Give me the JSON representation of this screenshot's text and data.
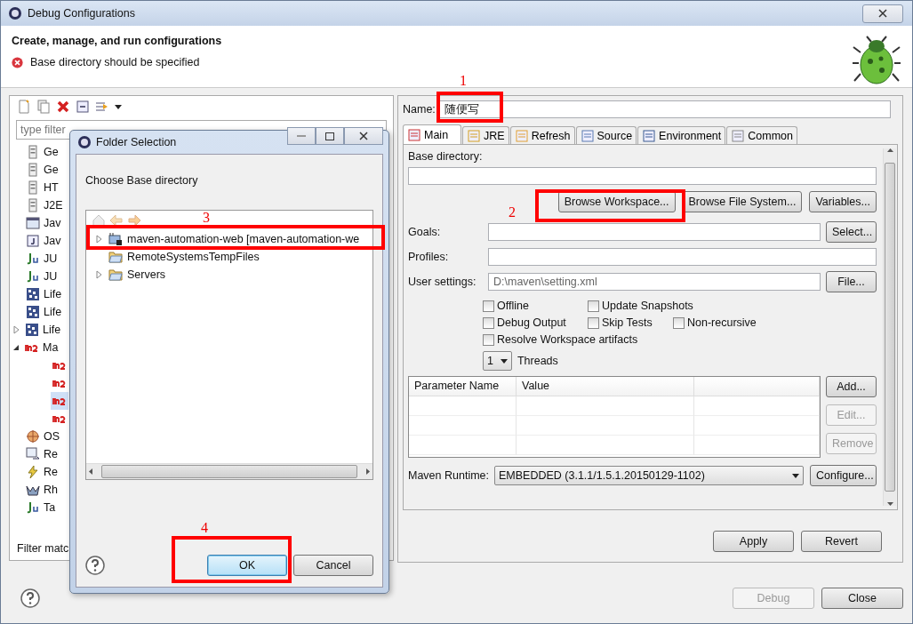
{
  "window": {
    "title": "Debug Configurations"
  },
  "header": {
    "title": "Create, manage, and run configurations",
    "error": "Base directory should be specified"
  },
  "left_panel": {
    "filter": {
      "placeholder": "type filter"
    },
    "items": [
      {
        "kind": "doc",
        "label": "Ge"
      },
      {
        "kind": "doc",
        "label": "Ge"
      },
      {
        "kind": "doc",
        "label": "HT"
      },
      {
        "kind": "doc",
        "label": "J2E"
      },
      {
        "kind": "javaapp",
        "label": "Jav"
      },
      {
        "kind": "javaclass",
        "label": "Jav"
      },
      {
        "kind": "junit",
        "label": "JU"
      },
      {
        "kind": "junit",
        "label": "JU"
      },
      {
        "kind": "lifecycle",
        "label": "Life"
      },
      {
        "kind": "lifecycle",
        "label": "Life"
      },
      {
        "kind": "lifecycle",
        "label": "Life",
        "expanded": false
      },
      {
        "kind": "maven",
        "label": "Ma",
        "expanded": true,
        "children": [
          {
            "kind": "maven",
            "selected": false
          },
          {
            "kind": "maven",
            "selected": false
          },
          {
            "kind": "maven",
            "selected": true
          },
          {
            "kind": "maven",
            "selected": false
          }
        ]
      },
      {
        "kind": "osgi",
        "label": "OS"
      },
      {
        "kind": "remote",
        "label": "Re"
      },
      {
        "kind": "bolt",
        "label": "Re"
      },
      {
        "kind": "rhino",
        "label": "Rh"
      },
      {
        "kind": "junit",
        "label": "Ta"
      }
    ],
    "status": "Filter matc"
  },
  "form": {
    "name_label": "Name:",
    "name_value": "随便写",
    "tabs": [
      {
        "label": "Main",
        "selected": true
      },
      {
        "label": "JRE",
        "selected": false
      },
      {
        "label": "Refresh",
        "selected": false
      },
      {
        "label": "Source",
        "selected": false
      },
      {
        "label": "Environment",
        "selected": false
      },
      {
        "label": "Common",
        "selected": false
      }
    ],
    "base_directory_label": "Base directory:",
    "browse_buttons": [
      "Browse Workspace...",
      "Browse File System...",
      "Variables..."
    ],
    "goals_label": "Goals:",
    "goals_button": "Select...",
    "profiles_label": "Profiles:",
    "user_settings_label": "User settings:",
    "user_settings_value": "D:\\maven\\setting.xml",
    "user_settings_button": "File...",
    "checkbox_rows": [
      [
        {
          "label": "Offline",
          "checked": false
        },
        {
          "label": "Update Snapshots",
          "checked": false
        }
      ],
      [
        {
          "label": "Debug Output",
          "checked": false
        },
        {
          "label": "Skip Tests",
          "checked": false
        },
        {
          "label": "Non-recursive",
          "checked": false
        }
      ],
      [
        {
          "label": "Resolve Workspace artifacts",
          "checked": false
        }
      ]
    ],
    "threads_value": "1",
    "threads_label": "Threads",
    "table": {
      "columns": [
        "Parameter Name",
        "Value"
      ]
    },
    "table_buttons": [
      {
        "label": "Add...",
        "disabled": false
      },
      {
        "label": "Edit...",
        "disabled": true
      },
      {
        "label": "Remove",
        "disabled": true
      }
    ],
    "runtime_label": "Maven Runtime:",
    "runtime_value": "EMBEDDED (3.1.1/1.5.1.20150129-1102)",
    "runtime_button": "Configure...",
    "actions": [
      {
        "label": "Apply",
        "disabled": false
      },
      {
        "label": "Revert",
        "disabled": false
      }
    ]
  },
  "footer": {
    "buttons": [
      {
        "label": "Debug",
        "disabled": true
      },
      {
        "label": "Close",
        "disabled": false
      }
    ]
  },
  "dialog": {
    "title": "Folder Selection",
    "prompt": "Choose Base directory",
    "tree": [
      {
        "label": "maven-automation-web [maven-automation-we",
        "kind": "project",
        "expanded": false
      },
      {
        "label": "RemoteSystemsTempFiles",
        "kind": "folder"
      },
      {
        "label": "Servers",
        "kind": "folder",
        "expanded": false
      }
    ],
    "buttons": [
      {
        "label": "OK",
        "default": true
      },
      {
        "label": "Cancel",
        "default": false
      }
    ]
  },
  "annotations": [
    {
      "label": "1"
    },
    {
      "label": "2"
    },
    {
      "label": "3"
    },
    {
      "label": "4"
    }
  ]
}
